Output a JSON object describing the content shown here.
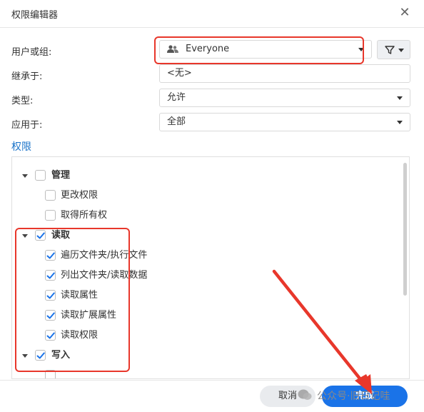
{
  "dialog": {
    "title": "权限编辑器"
  },
  "form": {
    "user_group_label": "用户或组:",
    "user_group_value": "Everyone",
    "inherit_label": "继承于:",
    "inherit_value": "<无>",
    "type_label": "类型:",
    "type_value": "允许",
    "apply_label": "应用于:",
    "apply_value": "全部"
  },
  "permissions": {
    "section_title": "权限",
    "items": [
      {
        "label": "管理",
        "level": 0,
        "checked": false,
        "bold": true,
        "expandable": true
      },
      {
        "label": "更改权限",
        "level": 1,
        "checked": false
      },
      {
        "label": "取得所有权",
        "level": 1,
        "checked": false
      },
      {
        "label": "读取",
        "level": 0,
        "checked": true,
        "bold": true,
        "expandable": true
      },
      {
        "label": "遍历文件夹/执行文件",
        "level": 1,
        "checked": true
      },
      {
        "label": "列出文件夹/读取数据",
        "level": 1,
        "checked": true
      },
      {
        "label": "读取属性",
        "level": 1,
        "checked": true
      },
      {
        "label": "读取扩展属性",
        "level": 1,
        "checked": true
      },
      {
        "label": "读取权限",
        "level": 1,
        "checked": true
      },
      {
        "label": "写入",
        "level": 0,
        "checked": true,
        "bold": true,
        "expandable": true
      }
    ]
  },
  "footer": {
    "cancel_label": "取消",
    "ok_label": "完成",
    "watermark": "公众号·旧日记哇"
  },
  "colors": {
    "accent": "#1a73e8",
    "highlight": "#e8372b",
    "section": "#1a73c9"
  },
  "icons": {
    "user_group": "users-icon",
    "filter": "filter-icon",
    "close": "close-icon"
  }
}
